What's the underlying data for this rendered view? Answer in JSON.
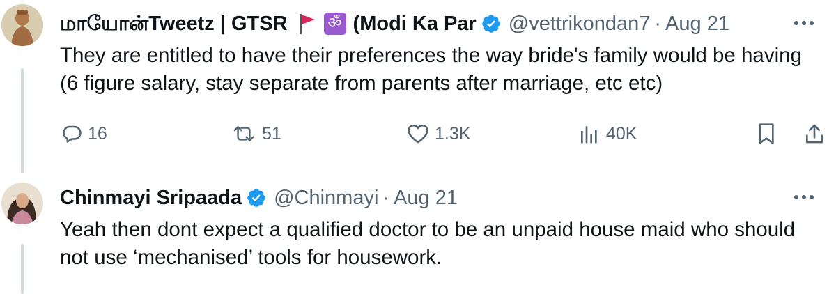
{
  "tweets": [
    {
      "display_name": "மாயோன்Tweetz | GTSR",
      "emoji_flag": "triangular-flag",
      "emoji_om": "ॐ",
      "name_suffix": "(Modi Ka Par",
      "handle": "@vettrikondan7",
      "separator": "·",
      "date": "Aug 21",
      "text": "They are entitled to have their preferences the way bride's family would be having (6 figure salary, stay separate from parents after marriage, etc etc)",
      "actions": {
        "replies": "16",
        "reposts": "51",
        "likes": "1.3K",
        "views": "40K"
      }
    },
    {
      "display_name": "Chinmayi Sripaada",
      "handle": "@Chinmayi",
      "separator": "·",
      "date": "Aug 21",
      "text": "Yeah then dont expect a qualified doctor to be an unpaid house maid who should not use ‘mechanised’ tools for housework."
    }
  ],
  "colors": {
    "text_primary": "#0f1419",
    "text_secondary": "#536471",
    "verified_blue": "#1d9bf0",
    "thread_line": "#cfd9de",
    "flag_red": "#e0245e",
    "om_purple": "#9b59d0"
  }
}
